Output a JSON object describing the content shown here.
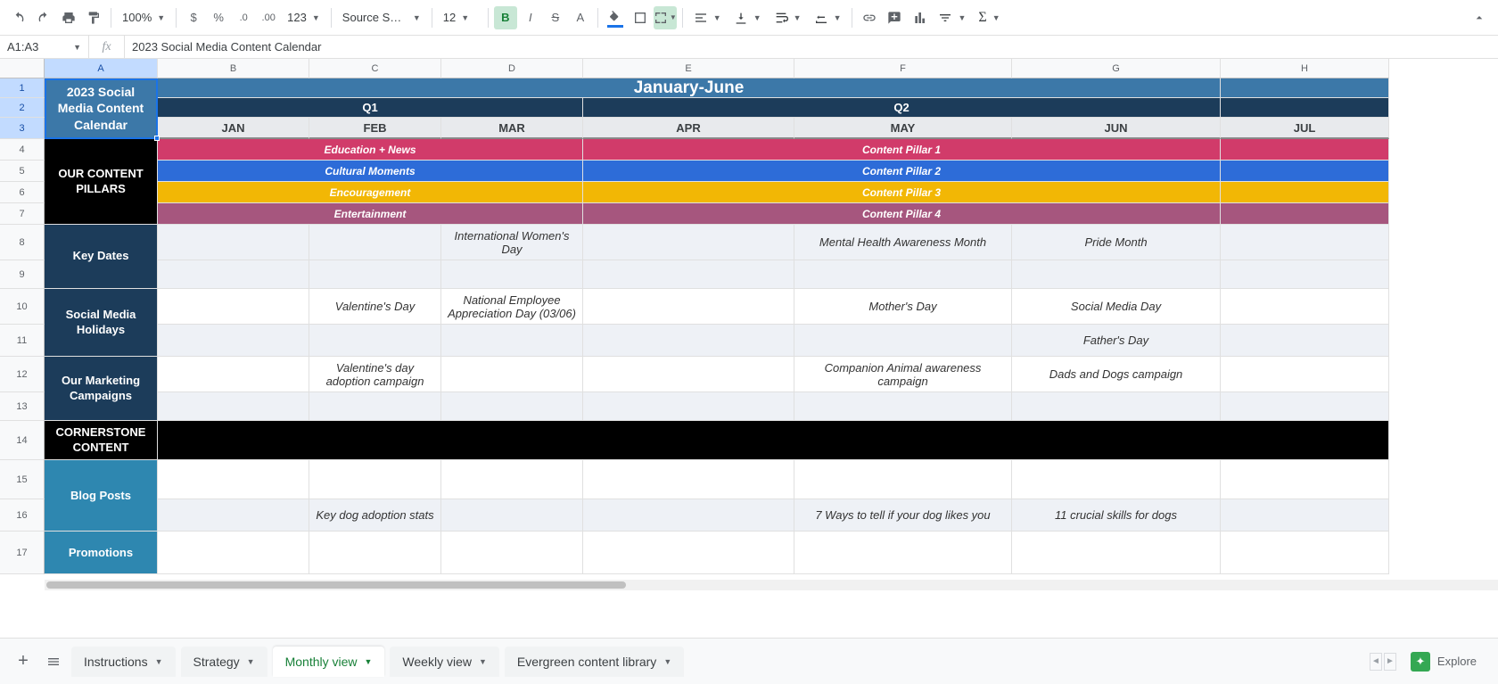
{
  "toolbar": {
    "zoom": "100%",
    "format_number": "123",
    "font": "Source San...",
    "font_size": "12"
  },
  "namebox": {
    "range": "A1:A3",
    "formula": "2023 Social Media Content Calendar"
  },
  "columns": [
    "A",
    "B",
    "C",
    "D",
    "E",
    "F",
    "G",
    "H"
  ],
  "rows": [
    "1",
    "2",
    "3",
    "4",
    "5",
    "6",
    "7",
    "8",
    "9",
    "10",
    "11",
    "12",
    "13",
    "14",
    "15",
    "16",
    "17"
  ],
  "chart_data": {
    "type": "table",
    "title_cell": "2023 Social Media Content Calendar",
    "period": "January-June",
    "quarters": {
      "q1": "Q1",
      "q2": "Q2"
    },
    "months": [
      "JAN",
      "FEB",
      "MAR",
      "APR",
      "MAY",
      "JUN",
      "JUL"
    ],
    "sections": {
      "content_pillars": "OUR CONTENT PILLARS",
      "key_dates": "Key Dates",
      "social_holidays": "Social Media Holidays",
      "campaigns": "Our Marketing Campaigns",
      "cornerstone": "CORNERSTONE CONTENT",
      "blog_posts": "Blog Posts",
      "promotions": "Promotions"
    },
    "pillars_q1": [
      "Education + News",
      "Cultural Moments",
      "Encouragement",
      "Entertainment"
    ],
    "pillars_q2": [
      "Content Pillar 1",
      "Content Pillar 2",
      "Content Pillar 3",
      "Content Pillar 4"
    ],
    "key_dates_row": {
      "MAR": "International Women's Day",
      "MAY": "Mental Health Awareness Month",
      "JUN": "Pride Month"
    },
    "social_holidays_rows": [
      {
        "FEB": "Valentine's Day",
        "MAR": "National Employee Appreciation Day (03/06)",
        "MAY": "Mother's Day",
        "JUN": "Social Media Day"
      },
      {
        "JUN": "Father's Day"
      }
    ],
    "campaigns_row": {
      "FEB": "Valentine's day adoption campaign",
      "MAY": "Companion Animal awareness campaign",
      "JUN": "Dads and Dogs campaign"
    },
    "blog_posts_row": {
      "FEB": "Key dog adoption stats",
      "MAY": "7 Ways to tell if your dog likes you",
      "JUN": "11 crucial skills for dogs"
    }
  },
  "sheets": {
    "instructions": "Instructions",
    "strategy": "Strategy",
    "monthly": "Monthly view",
    "weekly": "Weekly view",
    "evergreen": "Evergreen content library"
  },
  "explore": "Explore"
}
